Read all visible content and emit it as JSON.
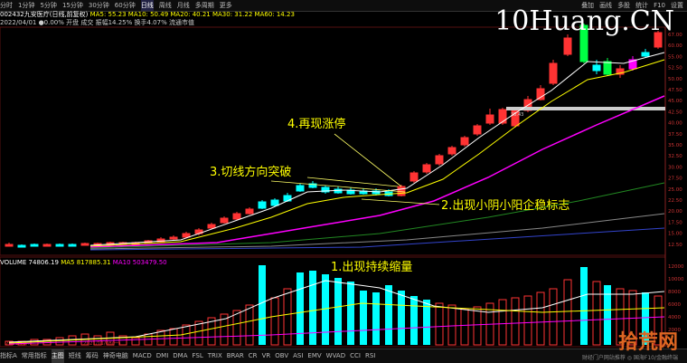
{
  "toolbar": {
    "periods": [
      "分时",
      "1分钟",
      "5分钟",
      "15分钟",
      "30分钟",
      "60分钟",
      "日线",
      "周线",
      "月线",
      "多周期",
      "更多"
    ],
    "selected": "日线",
    "right_items": [
      "叠加",
      "画线",
      "多股",
      "统计",
      "F10",
      "设置"
    ]
  },
  "info": {
    "line1_stock": "002432九安医疗(日线,前复权)",
    "line1_ma": "MA5: 55.23  MA10: 50.49  MA20: 40.21  MA30: 31.22  MA60: 14.23",
    "line2": "2022/04/01 ●0.00% 开盘 成交 振幅14.25% 换手4.07% 流通市值"
  },
  "watermark": "10Huang.CN",
  "annotations": {
    "a1": "1.出现持续缩量",
    "a2": "2.出现小阴小阳企稳标志",
    "a3": "3.切线方向突破",
    "a4": "4.再现涨停"
  },
  "volume_header": {
    "label": "VOLUME",
    "value": "74806.19",
    "ma5": "MA5 817885.31",
    "ma10": "MA10 503479.50"
  },
  "price_axis": [
    "67.00",
    "60.00",
    "55.00",
    "52.50",
    "50.00",
    "47.50",
    "45.00",
    "42.50",
    "40.00",
    "37.50",
    "35.00",
    "32.50",
    "30.00",
    "27.50",
    "25.00",
    "22.50",
    "20.00",
    "17.50",
    "15.00",
    "12.50"
  ],
  "volume_axis": [
    "12000",
    "10000",
    "8000",
    "6000",
    "4000",
    "2000"
  ],
  "support_label": "38.43",
  "date_labels": [
    "2021/10/..",
    "2021/11/08(一)"
  ],
  "bottom_tabs": [
    "指标A",
    "常用指标",
    "主图",
    "短线",
    "筹码",
    "神奇电脑",
    "MACD",
    "DMI",
    "DMA",
    "FSL",
    "TRIX",
    "BRAR",
    "CR",
    "VR",
    "OBV",
    "ASI",
    "EMV",
    "WVAD",
    "CCI",
    "RSI"
  ],
  "bottom_active": "主图",
  "logo": "拾荒网",
  "footer": "财经门户网站推荐 ◎ 国海F10/金融终端",
  "colors": {
    "up": "#ff3333",
    "down": "#00ffff",
    "green_bar": "#00ff44",
    "magenta_bar": "#ff00ff",
    "ma_white": "#ffffff",
    "ma_yellow": "#ffff00",
    "ma_magenta": "#ff00ff",
    "ma_green": "#00ff00",
    "ma_gray": "#888888",
    "support": "#cccccc"
  }
}
